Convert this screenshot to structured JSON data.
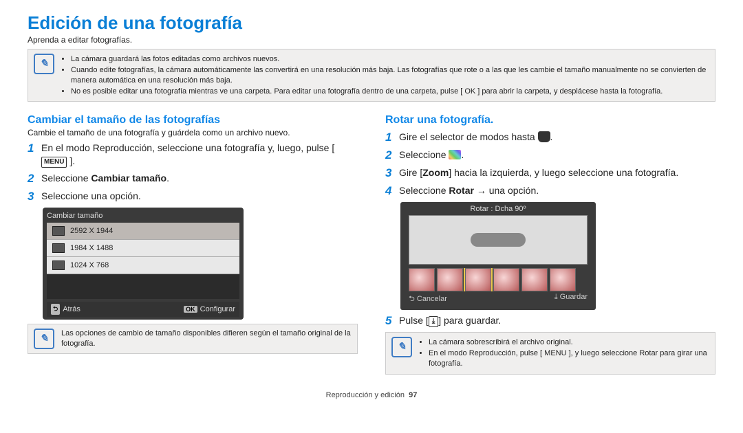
{
  "title": "Edición de una fotografía",
  "intro": "Aprenda a editar fotografías.",
  "topNotes": [
    "La cámara guardará las fotos editadas como archivos nuevos.",
    "Cuando edite fotografías, la cámara automáticamente las convertirá en una resolución más baja. Las fotografías que rote o a las que les cambie el tamaño manualmente no se convierten de manera automática en una resolución más baja.",
    "No es posible editar una fotografía mientras ve una carpeta. Para editar una fotografía dentro de una carpeta, pulse [ OK ] para abrir la carpeta, y desplácese hasta la fotografía."
  ],
  "left": {
    "heading": "Cambiar el tamaño de las fotografías",
    "sub": "Cambie el tamaño de una fotografía y guárdela como un archivo nuevo.",
    "step1_pre": "En el modo Reproducción, seleccione una fotografía y, luego, pulse [",
    "step1_post": "].",
    "menu_label": "MENU",
    "step2_pre": "Seleccione ",
    "step2_bold": "Cambiar tamaño",
    "step2_post": ".",
    "step3": "Seleccione una opción.",
    "ui": {
      "title": "Cambiar tamaño",
      "options": [
        "2592 X 1944",
        "1984 X 1488",
        "1024 X 768"
      ],
      "back": "Atrás",
      "ok": "OK",
      "configure": "Configurar"
    },
    "noteHeader": "Las opciones de cambio de tamaño disponibles difieren según el tamaño original de la fotografía."
  },
  "right": {
    "heading": "Rotar una fotografía.",
    "step1_pre": "Gire el selector de modos hasta ",
    "step1_post": ".",
    "step2_pre": "Seleccione ",
    "step2_post": ".",
    "step3_pre": "Gire [",
    "step3_bold": "Zoom",
    "step3_mid": "] hacia la izquierda, y luego seleccione una fotografía.",
    "step4_pre": "Seleccione ",
    "step4_bold": "Rotar",
    "step4_mid": " → una opción.",
    "ui": {
      "title": "Rotar : Dcha 90º",
      "cancel": "Cancelar",
      "save": "Guardar"
    },
    "step5_pre": "Pulse [",
    "step5_post": "] para guardar.",
    "down_glyph": "⤓",
    "notes": [
      "La cámara sobrescribirá el archivo original.",
      "En el modo Reproducción, pulse [ MENU ], y luego seleccione Rotar para girar una fotografía."
    ]
  },
  "footer": {
    "section": "Reproducción y edición",
    "page": "97"
  }
}
